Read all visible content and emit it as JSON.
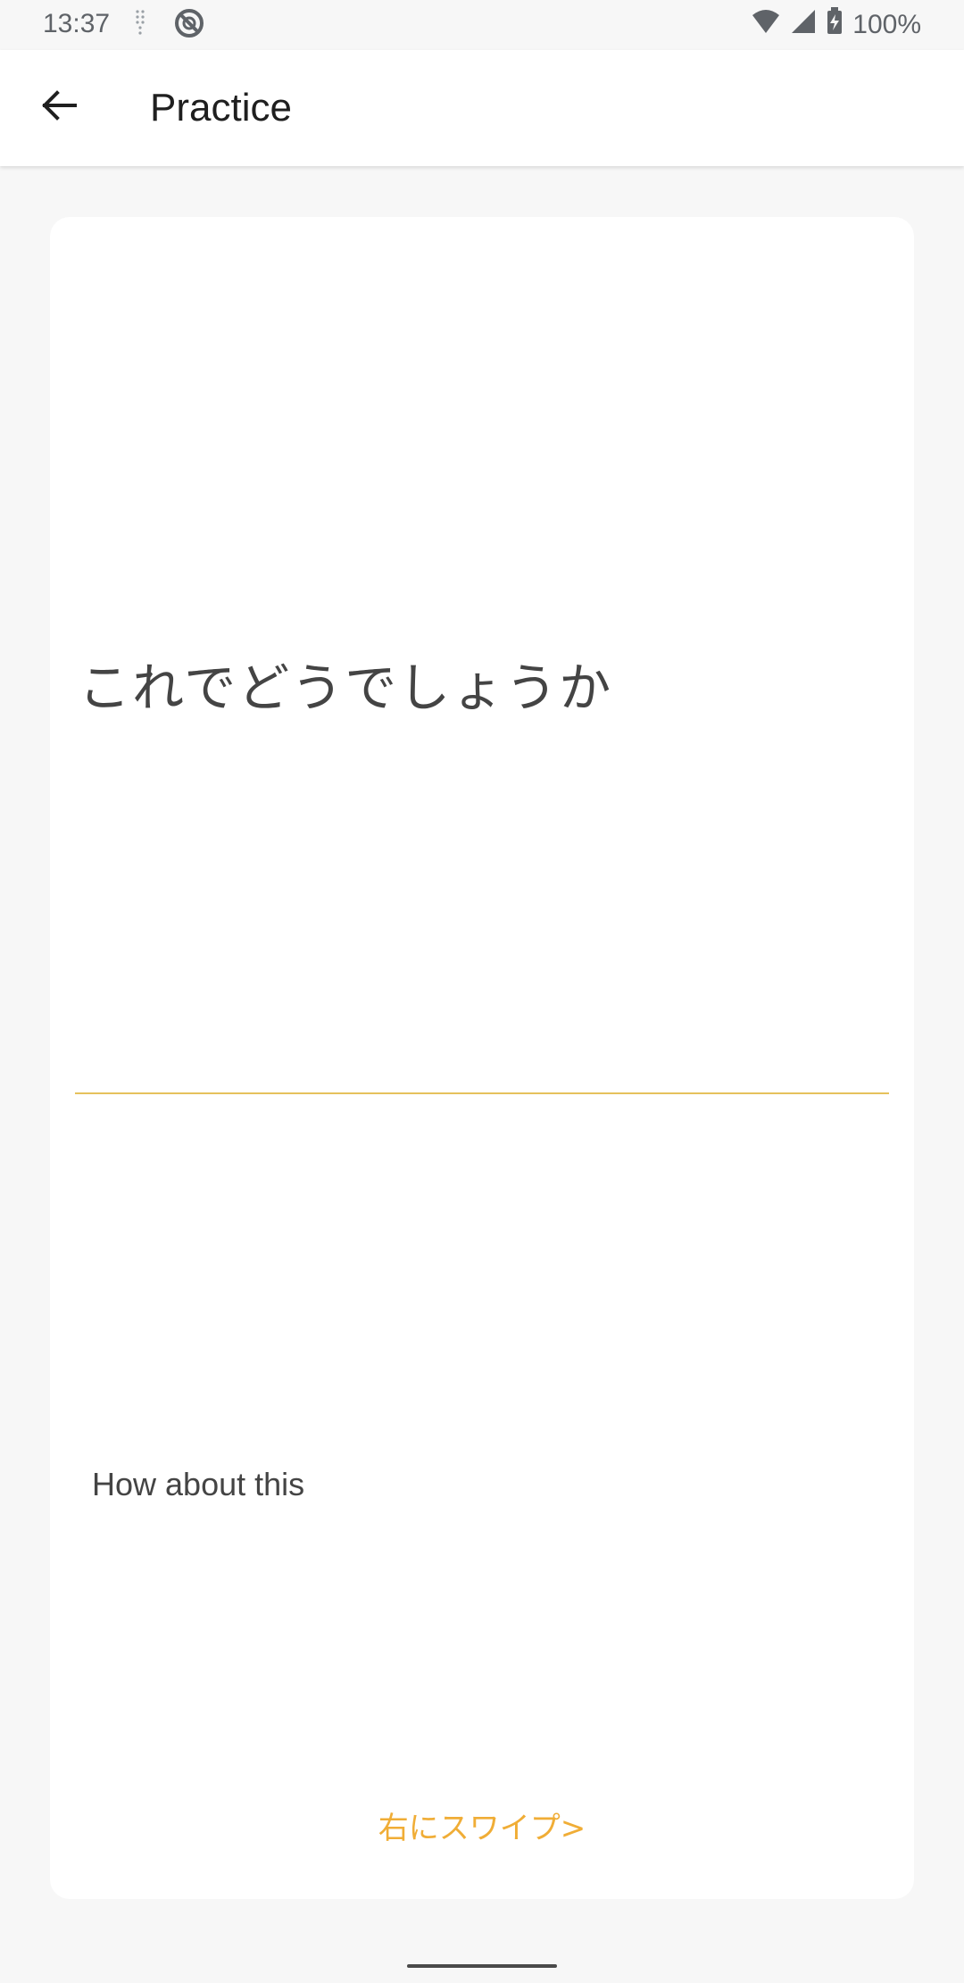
{
  "status_bar": {
    "time": "13:37",
    "battery": "100%",
    "icons": [
      "signal-dots-icon",
      "no-disturb-icon",
      "wifi-icon",
      "cell-signal-icon",
      "battery-charging-icon"
    ]
  },
  "app_bar": {
    "title": "Practice",
    "back_icon": "arrow-back-icon"
  },
  "card": {
    "japanese_phrase": "これでどうでしょうか",
    "english_translation": "How about this",
    "swipe_hint": "右にスワイプ>"
  },
  "colors": {
    "accent": "#f0ad36",
    "divider": "#e6c25c",
    "background": "#f7f7f7",
    "card": "#ffffff",
    "text": "#444444"
  }
}
